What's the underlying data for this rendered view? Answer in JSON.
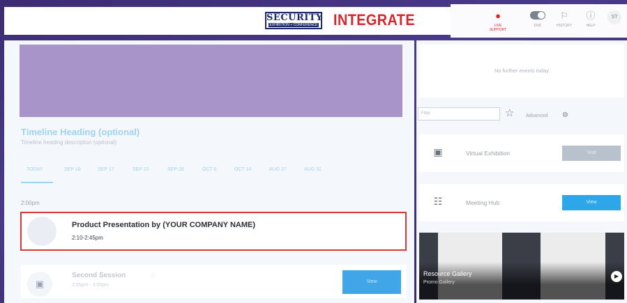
{
  "header": {
    "logo_main": "SECURITY",
    "logo_sub": "EXHIBITION + CONFERENCE",
    "brand": "INTEGRATE",
    "live_support_label": "LIVE SUPPORT",
    "dnd_label": "DND",
    "history_label": "HISTORY",
    "help_label": "HELP",
    "avatar_initials": "ST",
    "accent_color": "#d9262e"
  },
  "timeline": {
    "heading": "Timeline Heading (optional)",
    "description": "Timeline heading description (optional)",
    "tabs": [
      "TODAY",
      "SEP 16",
      "SEP 17",
      "SEP 22",
      "SEP 28",
      "OCT 6",
      "OCT 14",
      "AUG 27",
      "AUG 31"
    ],
    "active_tab": "TODAY",
    "time_group": "2:00pm"
  },
  "sessions": [
    {
      "title": "Product Presentation by (YOUR COMPANY NAME)",
      "time": "2:10-2:45pm",
      "highlight_color": "#d93a30"
    },
    {
      "title": "Second Session",
      "time": "2:55pm - 3:05pm",
      "button": "View"
    }
  ],
  "sidebar": {
    "no_events": "No further events today",
    "filter_placeholder": "Filter",
    "advanced_label": "Advanced",
    "cards": [
      {
        "label": "Virtual Exhibition",
        "button": "Visit",
        "icon": "screen-icon"
      },
      {
        "label": "Meeting Hub",
        "button": "View",
        "icon": "meeting-icon"
      }
    ],
    "gallery": {
      "title": "Resource Gallery",
      "subtitle": "Promo Gallery"
    }
  }
}
